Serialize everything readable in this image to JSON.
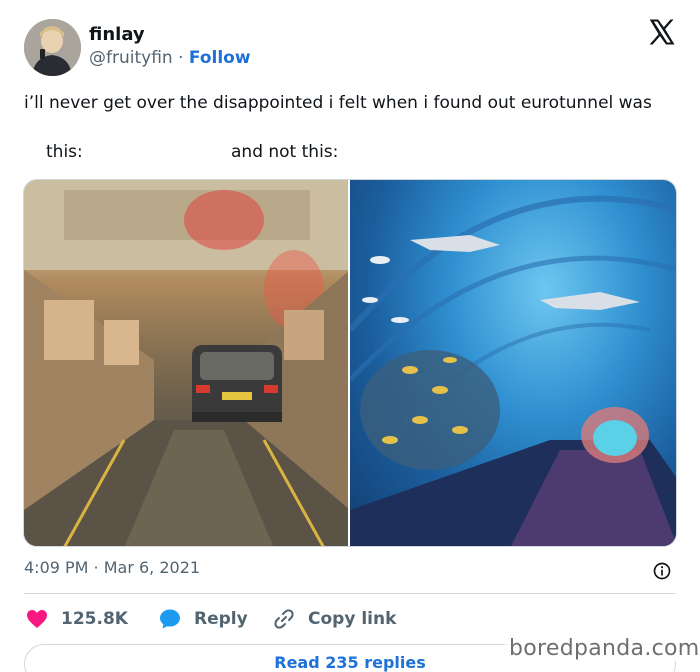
{
  "author": {
    "display_name": "finlay",
    "handle": "@fruityfin",
    "separator": "·",
    "follow_label": "Follow"
  },
  "tweet": {
    "text": "i’ll never get over the disappointed i felt when i found out eurotunnel was",
    "caption_left": "this:",
    "caption_right": "and not this:",
    "timestamp": "4:09 PM · Mar 6, 2021"
  },
  "actions": {
    "likes": "125.8K",
    "reply_label": "Reply",
    "copy_label": "Copy link",
    "read_replies": "Read 235 replies"
  },
  "watermark": "boredpanda.com",
  "colors": {
    "accent": "#1d71d9",
    "like": "#f91880",
    "reply": "#1d9bf0",
    "muted": "#536471"
  },
  "icons": {
    "brand": "x-logo-icon",
    "like": "heart-icon",
    "reply": "speech-bubble-icon",
    "copy": "link-icon",
    "info": "info-icon"
  }
}
